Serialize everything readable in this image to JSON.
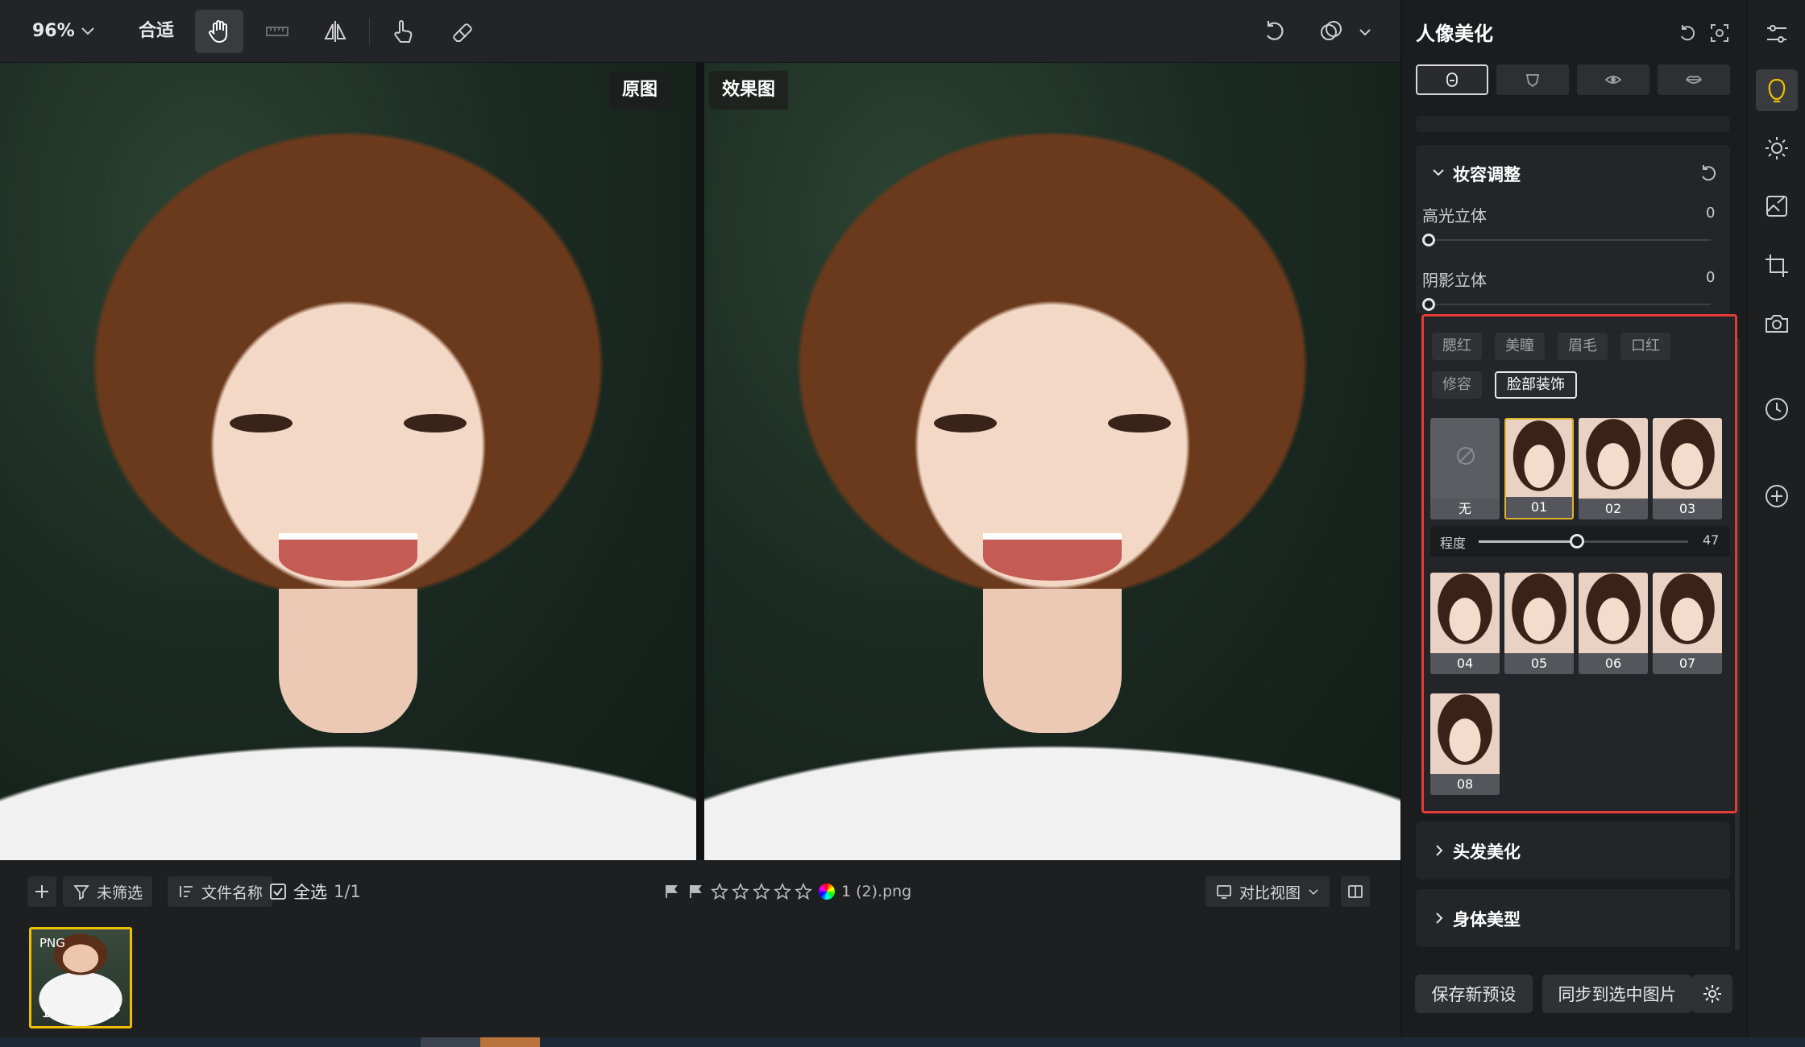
{
  "toolbar": {
    "zoom_value": "96%",
    "fit_label": "合适"
  },
  "canvas": {
    "original_label": "原图",
    "effect_label": "效果图"
  },
  "bottombar": {
    "filter_label": "未筛选",
    "sort_label": "文件名称",
    "select_all_label": "全选",
    "selection_count": "1/1",
    "rating_stars": 0,
    "file_name": "1 (2).png",
    "view_mode_label": "对比视图"
  },
  "thumbnail": {
    "format": "PNG",
    "index": "1"
  },
  "panel": {
    "title": "人像美化",
    "makeup_section": {
      "title": "妆容调整",
      "sliders": [
        {
          "label": "高光立体",
          "value": "0"
        },
        {
          "label": "阴影立体",
          "value": "0"
        }
      ],
      "chips": [
        "腮红",
        "美瞳",
        "眉毛",
        "口红",
        "修容",
        "脸部装饰"
      ],
      "active_chip": "脸部装饰",
      "presets": [
        {
          "label": "无"
        },
        {
          "label": "01"
        },
        {
          "label": "02"
        },
        {
          "label": "03"
        },
        {
          "label": "04"
        },
        {
          "label": "05"
        },
        {
          "label": "06"
        },
        {
          "label": "07"
        },
        {
          "label": "08"
        }
      ],
      "active_preset": "01",
      "intensity": {
        "label": "程度",
        "value": "47",
        "fraction": 0.47
      }
    },
    "hair_section": {
      "title": "头发美化"
    },
    "body_section": {
      "title": "身体美型"
    },
    "footer": {
      "save_preset_label": "保存新预设",
      "sync_label": "同步到选中图片"
    }
  },
  "colors": {
    "accent_yellow": "#e2b32d",
    "highlight_red": "#e33b36",
    "panel_bg": "#1b1c1e"
  }
}
